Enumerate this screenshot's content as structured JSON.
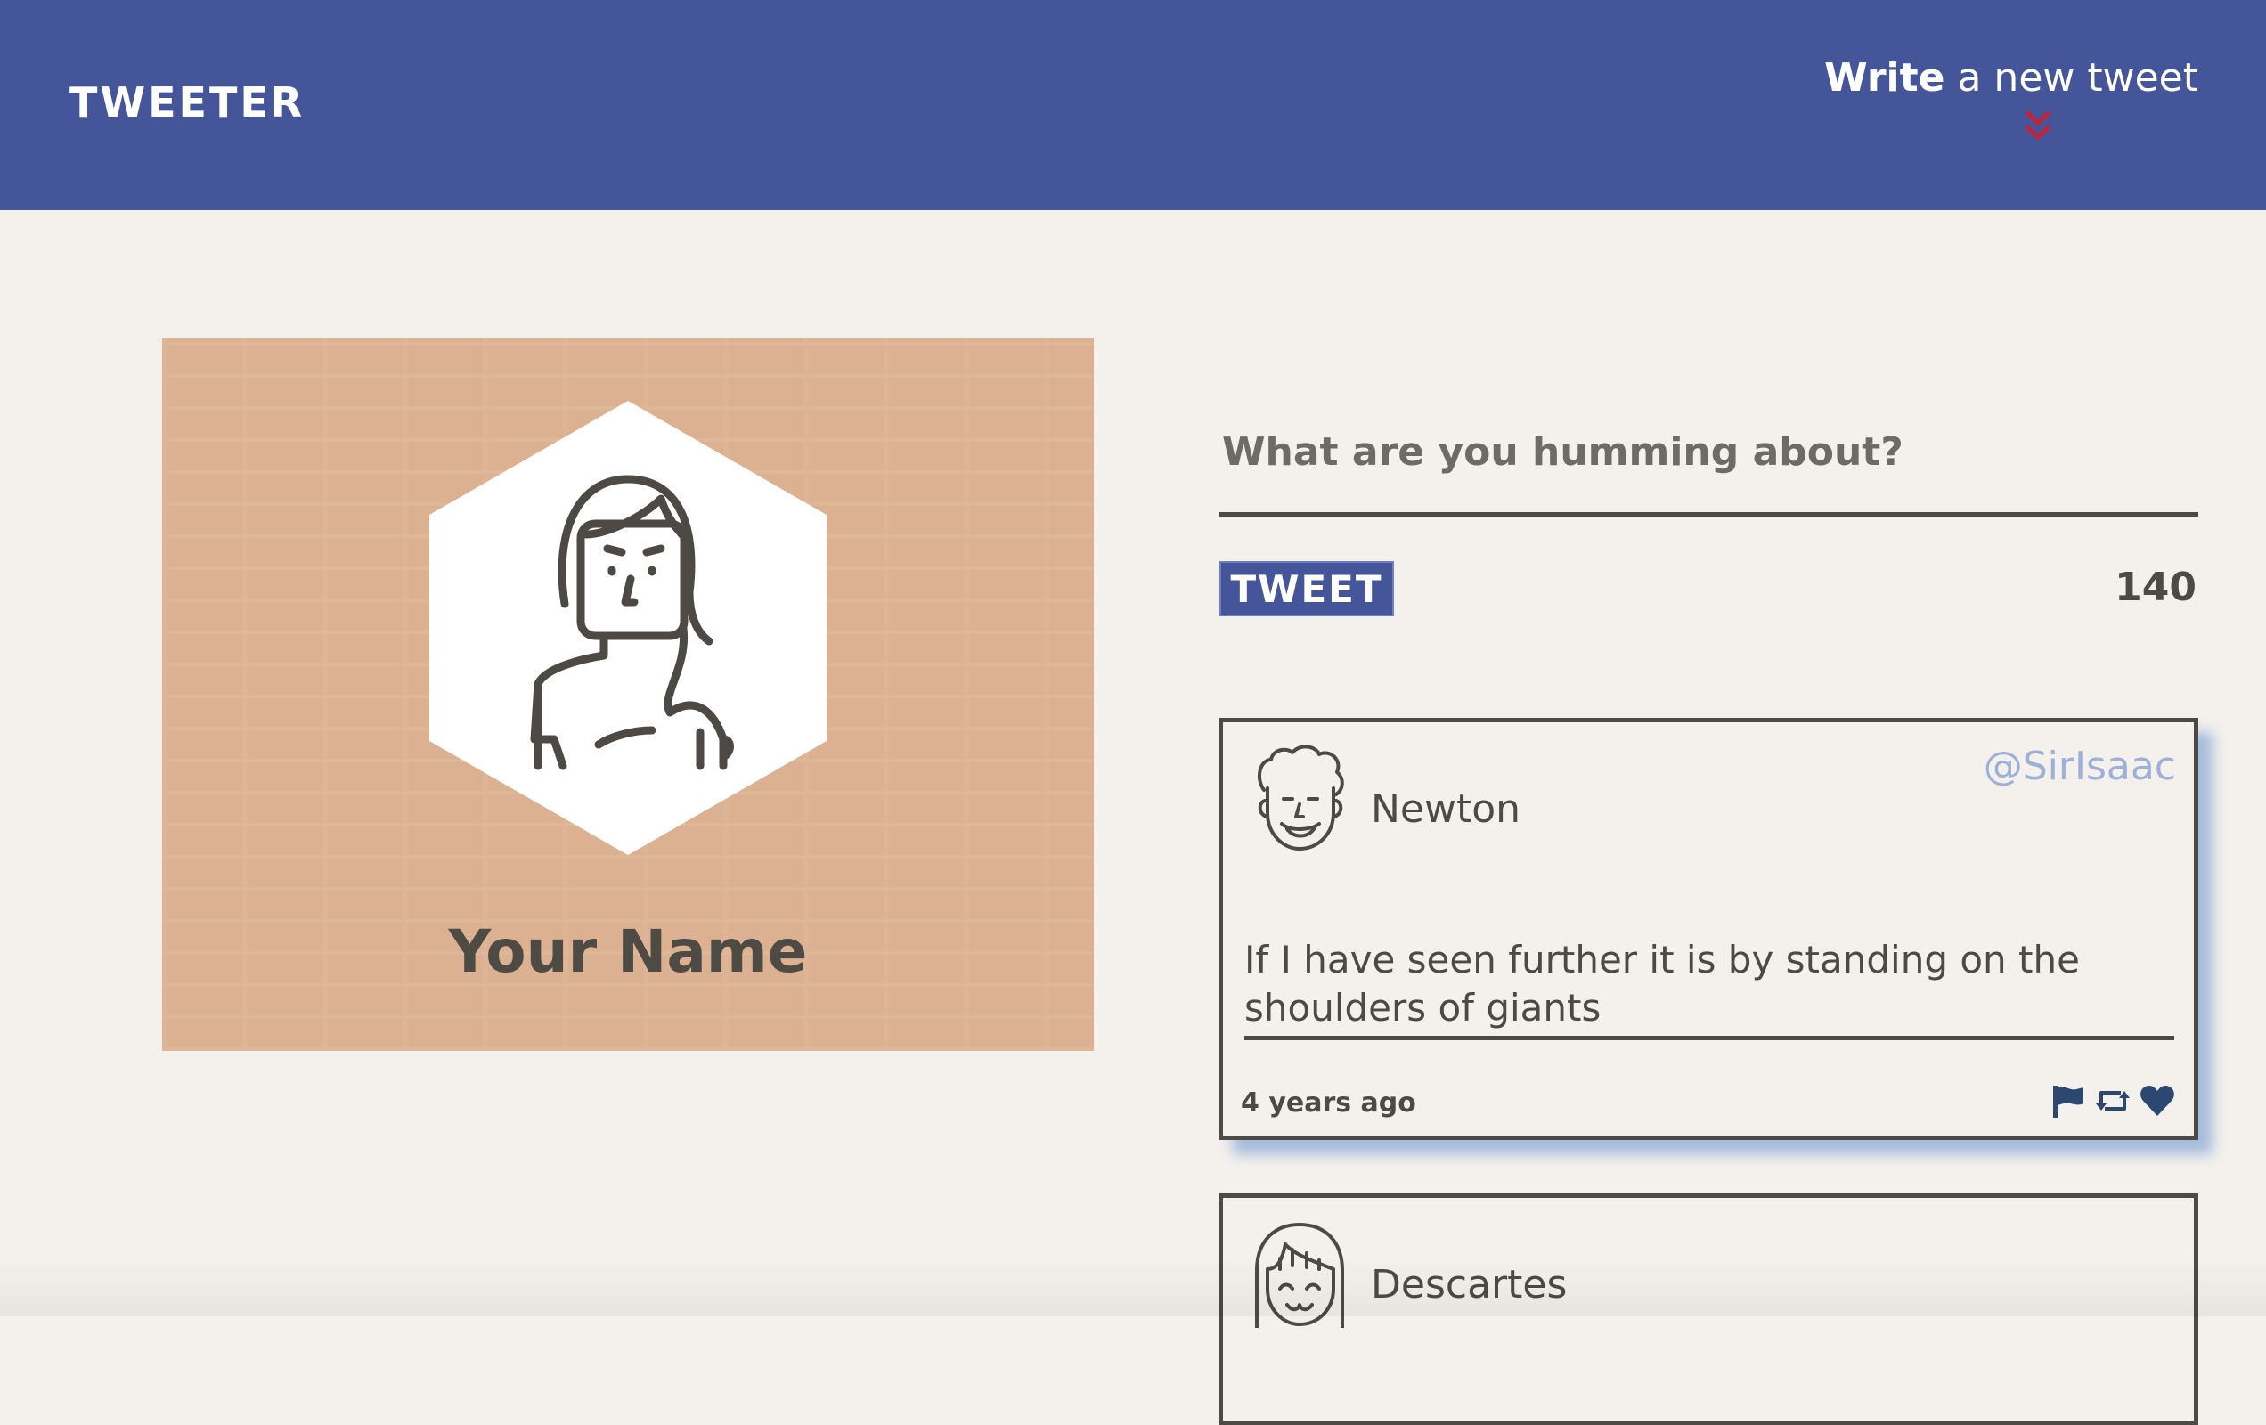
{
  "nav": {
    "logo": "TWEETER",
    "compose_bold": "Write",
    "compose_rest": " a new tweet",
    "arrow_color": "#c0243c"
  },
  "profile": {
    "name": "Your Name",
    "background_color": "#dcb192"
  },
  "compose": {
    "placeholder": "What are you humming about?",
    "button_label": "TWEET",
    "counter": "140"
  },
  "tweets": [
    {
      "name": "Newton",
      "handle": "@SirIsaac",
      "avatar": "curly-hair-man-avatar-icon",
      "content": "If I have seen further it is by standing on the shoulders of giants",
      "time": "4 years ago",
      "actions": [
        "flag-icon",
        "retweet-icon",
        "heart-icon"
      ]
    },
    {
      "name": "Descartes",
      "avatar": "bangs-smiling-avatar-icon"
    }
  ],
  "colors": {
    "nav": "#44559a",
    "page": "#f4f1ec",
    "text": "#4d4a45",
    "handle": "#9db0d8",
    "icon": "#2d4870"
  }
}
